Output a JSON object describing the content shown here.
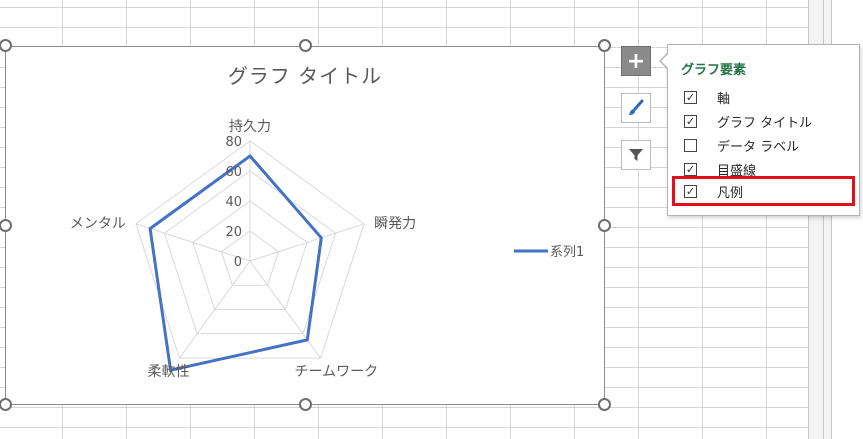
{
  "chart": {
    "title": "グラフ タイトル",
    "legend_position": "right"
  },
  "chart_data": {
    "type": "radar",
    "title": "グラフ タイトル",
    "categories": [
      "持久力",
      "瞬発力",
      "チームワーク",
      "柔軟性",
      "メンタル"
    ],
    "series": [
      {
        "name": "系列1",
        "values": [
          70,
          50,
          65,
          90,
          70
        ],
        "color": "#4472c4"
      }
    ],
    "rlim": [
      0,
      80
    ],
    "ticks": [
      "0",
      "20",
      "40",
      "60",
      "80"
    ],
    "grid": true,
    "legend": "right"
  },
  "side_buttons": {
    "elements": {
      "icon": "plus-icon"
    },
    "styles": {
      "icon": "brush-icon"
    },
    "filter": {
      "icon": "filter-icon"
    }
  },
  "popup": {
    "title": "グラフ要素",
    "items": [
      {
        "label": "軸",
        "checked": true
      },
      {
        "label": "グラフ タイトル",
        "checked": true
      },
      {
        "label": "データ ラベル",
        "checked": false
      },
      {
        "label": "目盛線",
        "checked": true
      },
      {
        "label": "凡例",
        "checked": true
      }
    ],
    "highlight_color": "#e3101c"
  },
  "colors": {
    "series": "#4472c4",
    "grid": "#d9d9d9",
    "axis_text": "#595959",
    "popup_title": "#217346"
  }
}
